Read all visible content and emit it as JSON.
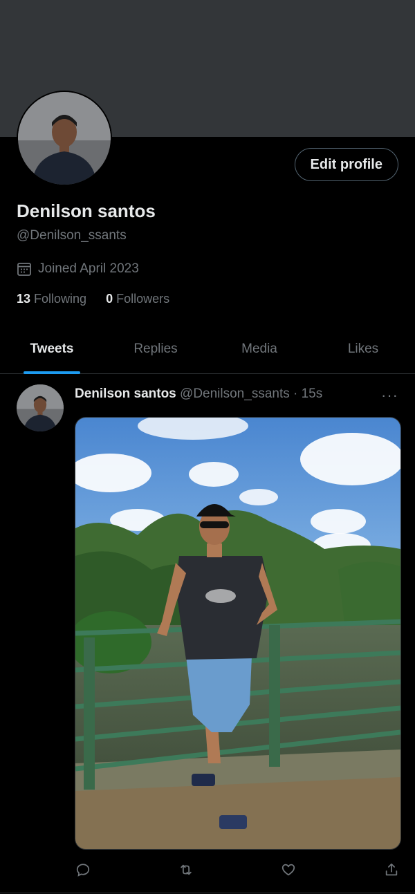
{
  "profile": {
    "name": "Denilson santos",
    "handle": "@Denilson_ssants",
    "joined": "Joined April 2023",
    "following_count": "13",
    "following_label": "Following",
    "followers_count": "0",
    "followers_label": "Followers",
    "edit_button": "Edit profile"
  },
  "tabs": [
    "Tweets",
    "Replies",
    "Media",
    "Likes"
  ],
  "active_tab": "Tweets",
  "tweet": {
    "author": "Denilson santos",
    "meta": "@Denilson_ssants · 15s",
    "more": "···"
  },
  "colors": {
    "accent": "#1d9bf0",
    "background": "#000000",
    "banner": "#333639",
    "muted": "#71767b"
  },
  "icons": [
    "calendar-icon",
    "more-icon",
    "reply-icon",
    "retweet-icon",
    "like-icon",
    "share-icon"
  ]
}
